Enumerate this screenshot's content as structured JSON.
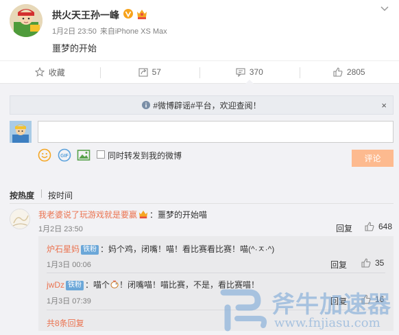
{
  "post": {
    "author": "拱火天王孙一峰",
    "time": "1月2日 23:50",
    "source_prefix": "来自",
    "source": "iPhone XS Max",
    "content": "噩梦的开始"
  },
  "actions": [
    {
      "label": "收藏",
      "icon": "star-icon"
    },
    {
      "label": "57",
      "icon": "forward-icon"
    },
    {
      "label": "370",
      "icon": "comment-icon"
    },
    {
      "label": "2805",
      "icon": "thumbs-up-icon"
    }
  ],
  "notice": {
    "text": "#微博辟谣#平台，欢迎查阅！",
    "close": "×"
  },
  "composer": {
    "placeholder": "",
    "forward_label": "同时转发到我的微博",
    "submit_label": "评论"
  },
  "sort": {
    "hot": "按热度",
    "time": "按时间"
  },
  "comment": {
    "user": "我老婆说了玩游戏就是要赢",
    "text": "：噩梦的开始喵",
    "time": "1月2日 23:50",
    "reply_label": "回复",
    "likes": "648"
  },
  "replies": [
    {
      "user": "炉石星妈",
      "badge": "铁粉",
      "text": "：妈个鸡，闭嘴！喵！看比赛看比赛！喵(^·ㅈ·^)",
      "time": "1月3日 00:06",
      "reply_label": "回复",
      "likes": "35"
    },
    {
      "user": "jwDz",
      "badge": "铁粉",
      "text_before": "：喵个",
      "text_after": "！闭嘴喵！喵比赛，不是，看比赛喵！",
      "time": "1月3日 07:39",
      "reply_label": "回复",
      "likes": "16"
    }
  ],
  "more_replies": "共8条回复",
  "watermark": {
    "title": "斧牛加速器",
    "url": "www.fnjiasu.com"
  },
  "colors": {
    "accent": "#eb7350",
    "link": "#eb7350",
    "submit_bg": "#fdba8f",
    "page_bg": "#f2f2f5"
  }
}
